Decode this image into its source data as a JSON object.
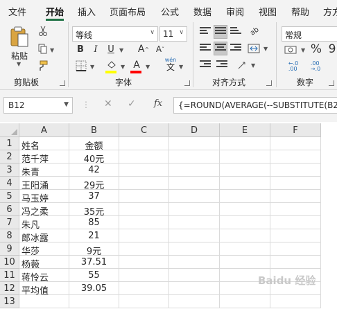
{
  "tabs": [
    "文件",
    "开始",
    "插入",
    "页面布局",
    "公式",
    "数据",
    "审阅",
    "视图",
    "帮助",
    "方方"
  ],
  "ribbon": {
    "clipboard": {
      "paste_label": "粘贴",
      "group_label": "剪贴板"
    },
    "font": {
      "name": "等线",
      "size": "11",
      "group_label": "字体",
      "bold": "B",
      "italic": "I",
      "underline": "U",
      "grow": "A",
      "shrink": "A",
      "font_color_letter": "A",
      "phonetic": "wén",
      "phonetic_char": "文",
      "font_color": "#ff0000",
      "highlight_color": "#ffff00"
    },
    "alignment": {
      "group_label": "对齐方式",
      "wrap": "ab"
    },
    "number": {
      "format": "常规",
      "group_label": "数字",
      "percent": "%",
      "comma": "9"
    }
  },
  "formula_bar": {
    "name_box": "B12",
    "cancel": "✕",
    "enter": "✓",
    "fx": "fx",
    "formula": "{=ROUND(AVERAGE(--SUBSTITUTE(B2"
  },
  "grid": {
    "columns": [
      "A",
      "B",
      "C",
      "D",
      "E",
      "F"
    ],
    "rows": [
      {
        "n": "1",
        "a": "姓名",
        "b": "金额"
      },
      {
        "n": "2",
        "a": "范千萍",
        "b": "40元"
      },
      {
        "n": "3",
        "a": "朱青",
        "b": "42"
      },
      {
        "n": "4",
        "a": "王阳涌",
        "b": "29元"
      },
      {
        "n": "5",
        "a": "马玉婷",
        "b": "37"
      },
      {
        "n": "6",
        "a": "冯之柔",
        "b": "35元"
      },
      {
        "n": "7",
        "a": "朱凡",
        "b": "85"
      },
      {
        "n": "8",
        "a": "郎冰露",
        "b": "21"
      },
      {
        "n": "9",
        "a": "华莎",
        "b": "9元"
      },
      {
        "n": "10",
        "a": "杨薇",
        "b": "37.51"
      },
      {
        "n": "11",
        "a": "蒋怜云",
        "b": "55"
      },
      {
        "n": "12",
        "a": "平均值",
        "b": "39.05"
      },
      {
        "n": "13",
        "a": "",
        "b": ""
      }
    ]
  },
  "watermark": "Baidu 经验"
}
